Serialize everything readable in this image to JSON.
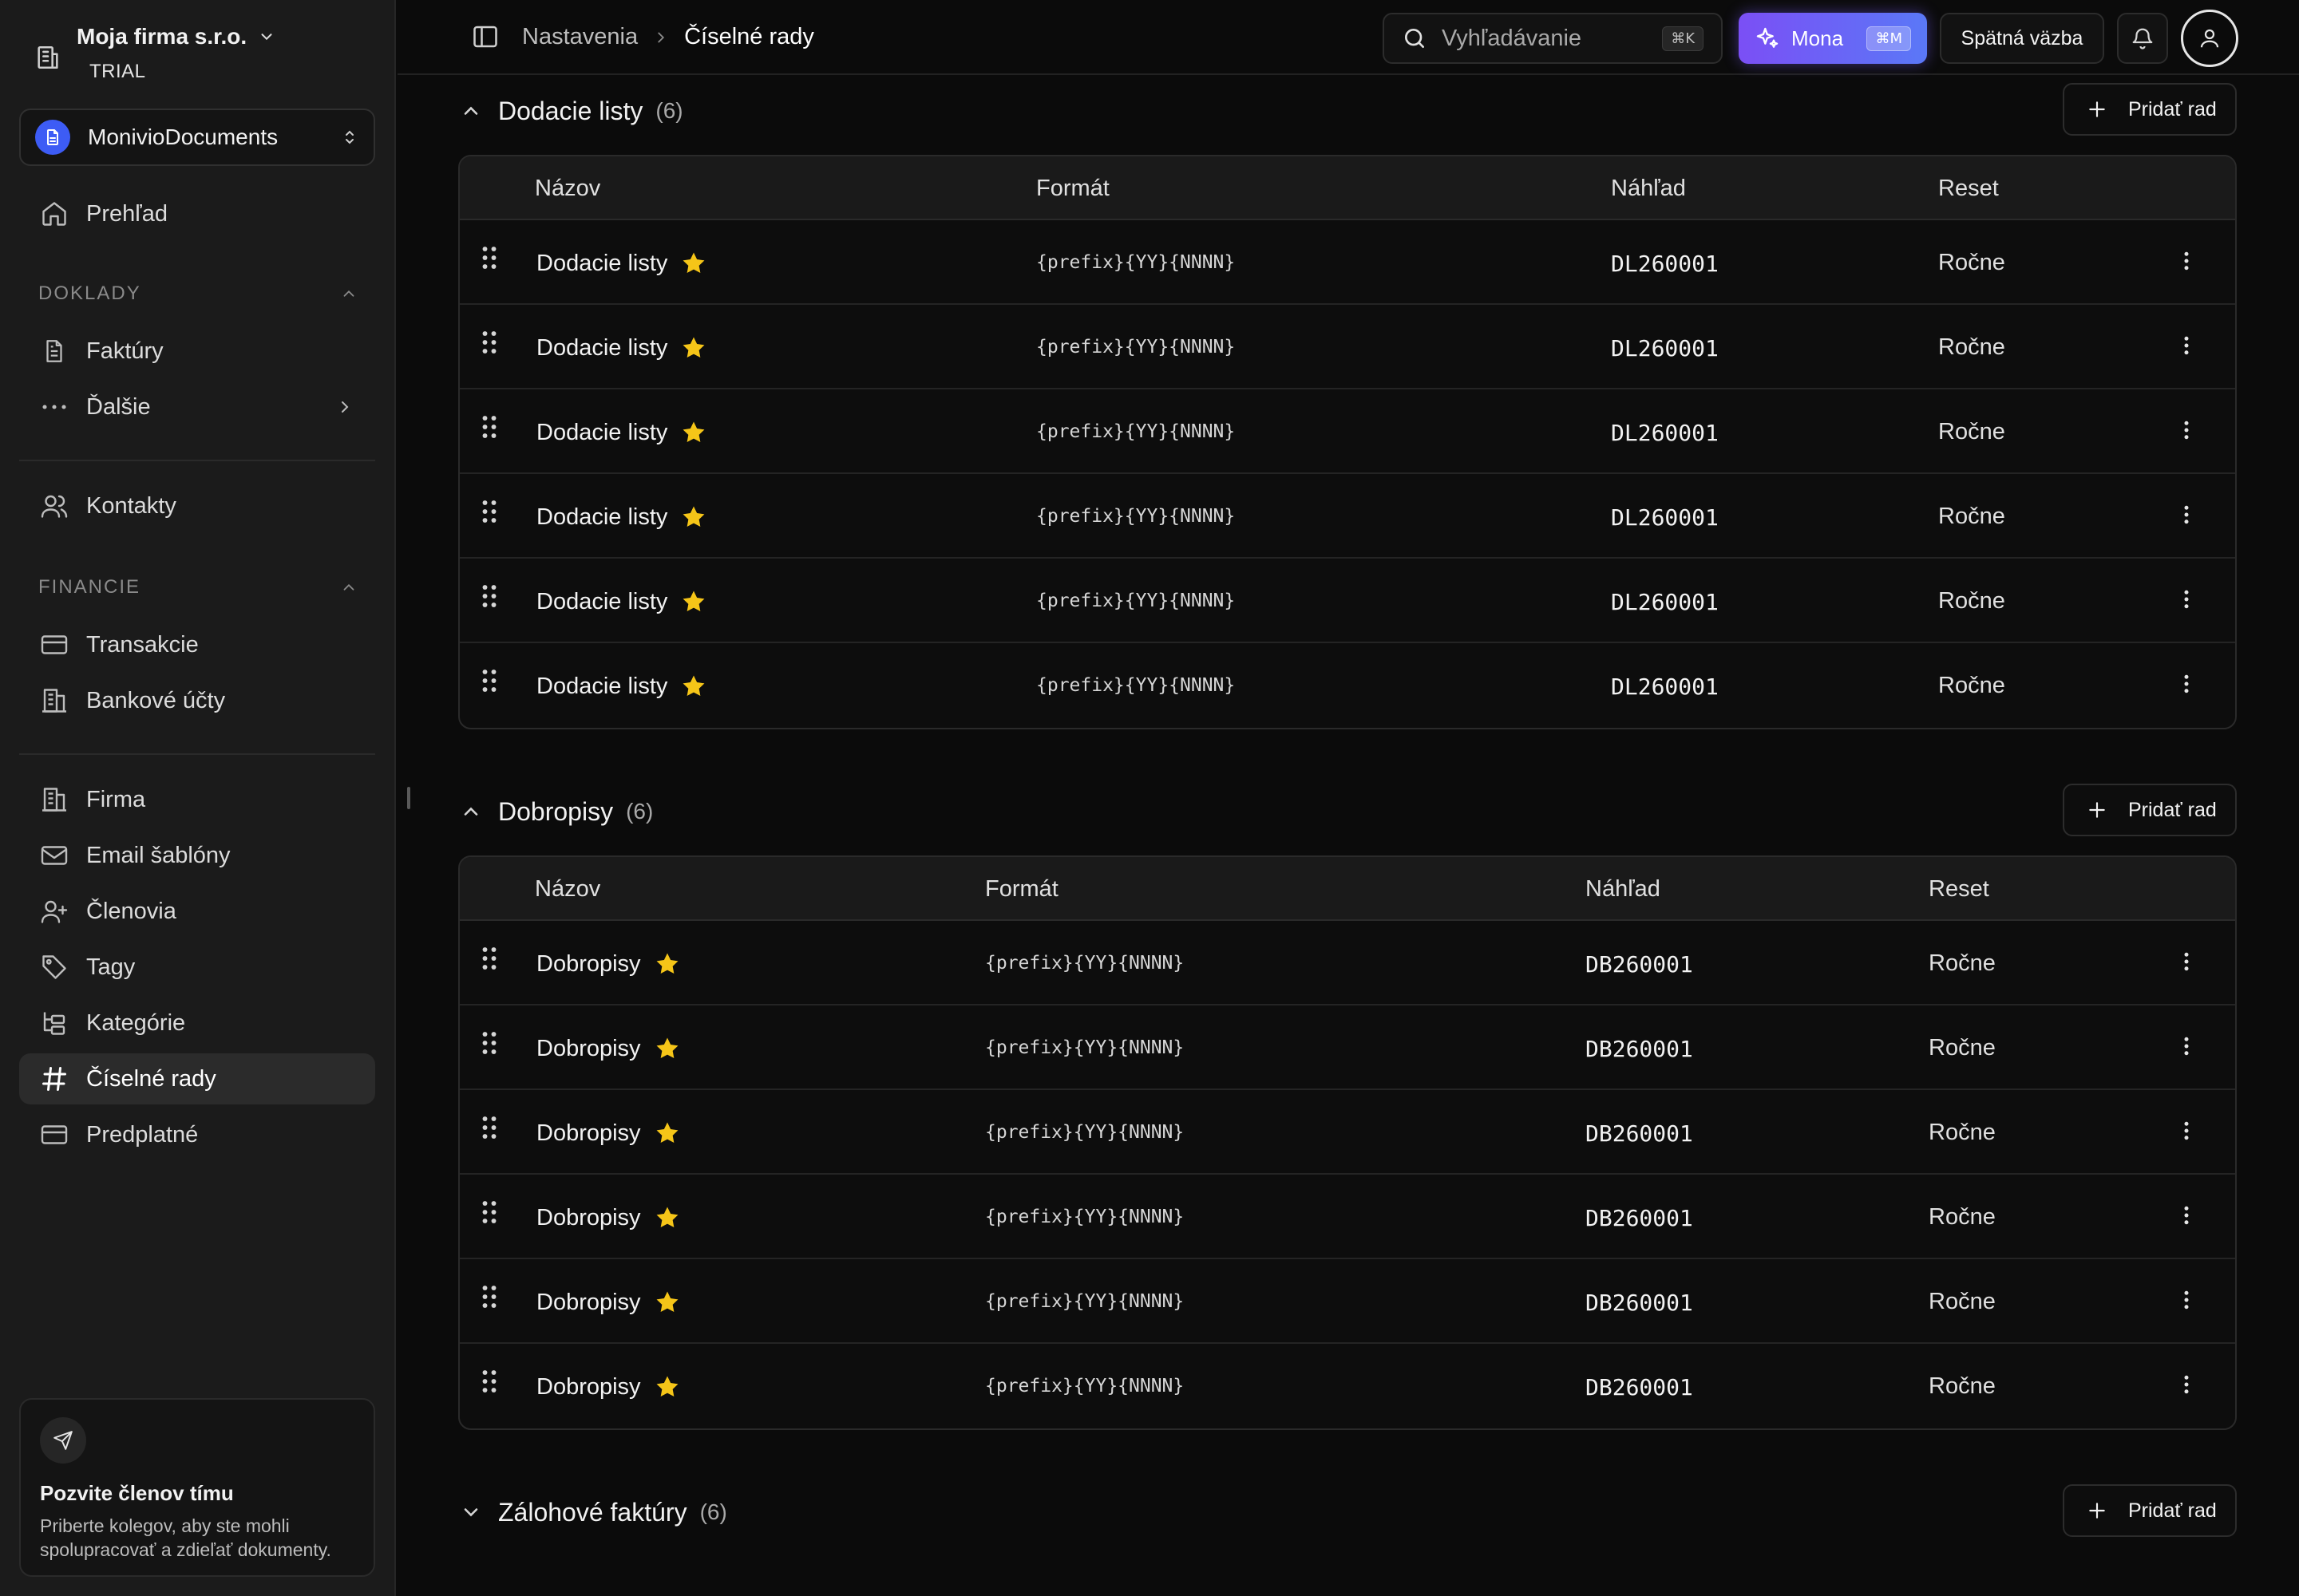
{
  "workspace": {
    "name": "Moja firma s.r.o.",
    "plan": "TRIAL"
  },
  "app": {
    "name": "MonivioDocuments"
  },
  "sidebar": {
    "overview": "Prehľad",
    "doklady_label": "DOKLADY",
    "faktury": "Faktúry",
    "dalsie": "Ďalšie",
    "kontakty": "Kontakty",
    "financie_label": "FINANCIE",
    "transakcie": "Transakcie",
    "bankove_ucty": "Bankové účty",
    "firma": "Firma",
    "email_sablony": "Email šablóny",
    "clenovia": "Členovia",
    "tagy": "Tagy",
    "kategorie": "Kategórie",
    "ciselne_rady": "Číselné rady",
    "predplatne": "Predplatné",
    "active_item": "ciselne_rady"
  },
  "invite": {
    "title": "Pozvite členov tímu",
    "text": "Priberte kolegov, aby ste mohli spolupracovať a zdieľať dokumenty."
  },
  "topbar": {
    "breadcrumb_parent": "Nastavenia",
    "breadcrumb_current": "Číselné rady",
    "search_placeholder": "Vyhľadávanie",
    "search_shortcut": "⌘K",
    "mona_label": "Mona",
    "mona_shortcut": "⌘M",
    "feedback_label": "Spätná väzba"
  },
  "columns": {
    "name": "Názov",
    "format": "Formát",
    "preview": "Náhľad",
    "reset": "Reset"
  },
  "add_label": "Pridať rad",
  "sections": [
    {
      "title": "Dodacie listy",
      "count": "(6)",
      "expanded": true,
      "rows": [
        {
          "name": "Dodacie listy",
          "format": "{prefix}{YY}{NNNN}",
          "preview": "DL260001",
          "reset": "Ročne"
        },
        {
          "name": "Dodacie listy",
          "format": "{prefix}{YY}{NNNN}",
          "preview": "DL260001",
          "reset": "Ročne"
        },
        {
          "name": "Dodacie listy",
          "format": "{prefix}{YY}{NNNN}",
          "preview": "DL260001",
          "reset": "Ročne"
        },
        {
          "name": "Dodacie listy",
          "format": "{prefix}{YY}{NNNN}",
          "preview": "DL260001",
          "reset": "Ročne"
        },
        {
          "name": "Dodacie listy",
          "format": "{prefix}{YY}{NNNN}",
          "preview": "DL260001",
          "reset": "Ročne"
        },
        {
          "name": "Dodacie listy",
          "format": "{prefix}{YY}{NNNN}",
          "preview": "DL260001",
          "reset": "Ročne"
        }
      ]
    },
    {
      "title": "Dobropisy",
      "count": "(6)",
      "expanded": true,
      "rows": [
        {
          "name": "Dobropisy",
          "format": "{prefix}{YY}{NNNN}",
          "preview": "DB260001",
          "reset": "Ročne"
        },
        {
          "name": "Dobropisy",
          "format": "{prefix}{YY}{NNNN}",
          "preview": "DB260001",
          "reset": "Ročne"
        },
        {
          "name": "Dobropisy",
          "format": "{prefix}{YY}{NNNN}",
          "preview": "DB260001",
          "reset": "Ročne"
        },
        {
          "name": "Dobropisy",
          "format": "{prefix}{YY}{NNNN}",
          "preview": "DB260001",
          "reset": "Ročne"
        },
        {
          "name": "Dobropisy",
          "format": "{prefix}{YY}{NNNN}",
          "preview": "DB260001",
          "reset": "Ročne"
        },
        {
          "name": "Dobropisy",
          "format": "{prefix}{YY}{NNNN}",
          "preview": "DB260001",
          "reset": "Ročne"
        }
      ]
    },
    {
      "title": "Zálohové faktúry",
      "count": "(6)",
      "expanded": false,
      "rows": []
    }
  ],
  "colors": {
    "accent": "#7b4ff5",
    "accent2": "#5a78f7",
    "star": "#f5c518",
    "app_badge": "#3d5cf5"
  }
}
